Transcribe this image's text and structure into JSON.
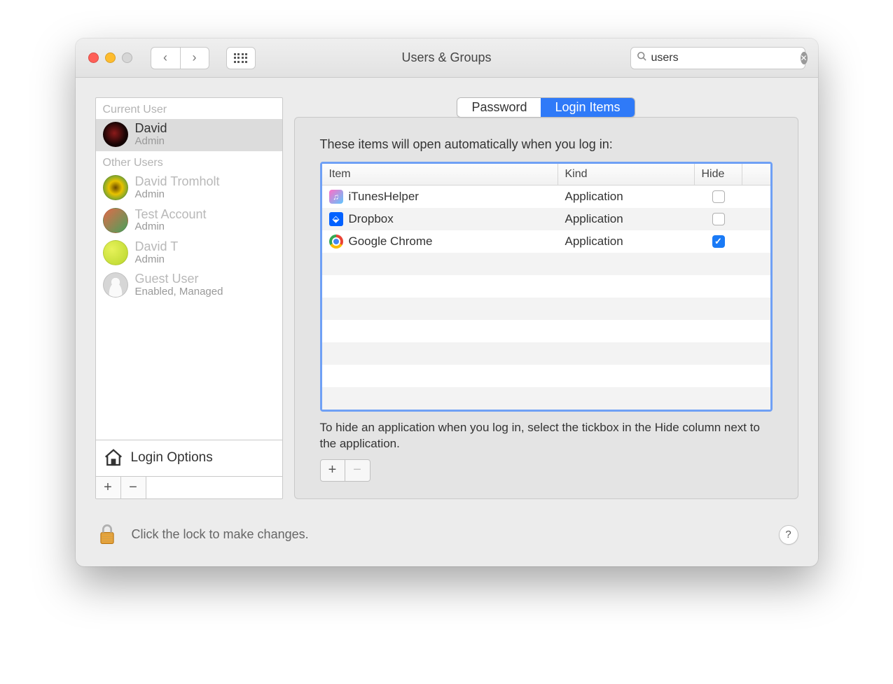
{
  "window": {
    "title": "Users & Groups"
  },
  "search": {
    "value": "users"
  },
  "sidebar": {
    "current_hdr": "Current User",
    "other_hdr": "Other Users",
    "current": {
      "name": "David",
      "role": "Admin"
    },
    "others": [
      {
        "name": "David Tromholt",
        "role": "Admin"
      },
      {
        "name": "Test Account",
        "role": "Admin"
      },
      {
        "name": "David T",
        "role": "Admin"
      },
      {
        "name": "Guest User",
        "role": "Enabled, Managed"
      }
    ],
    "login_options": "Login Options"
  },
  "tabs": {
    "password": "Password",
    "login_items": "Login Items"
  },
  "main": {
    "desc": "These items will open automatically when you log in:",
    "columns": {
      "item": "Item",
      "kind": "Kind",
      "hide": "Hide"
    },
    "rows": [
      {
        "name": "iTunesHelper",
        "kind": "Application",
        "hide": false,
        "icon": "itunes"
      },
      {
        "name": "Dropbox",
        "kind": "Application",
        "hide": false,
        "icon": "dropbox"
      },
      {
        "name": "Google Chrome",
        "kind": "Application",
        "hide": true,
        "icon": "chrome"
      }
    ],
    "hint": "To hide an application when you log in, select the tickbox in the Hide column next to the application."
  },
  "footer": {
    "lock_text": "Click the lock to make changes.",
    "help": "?"
  }
}
